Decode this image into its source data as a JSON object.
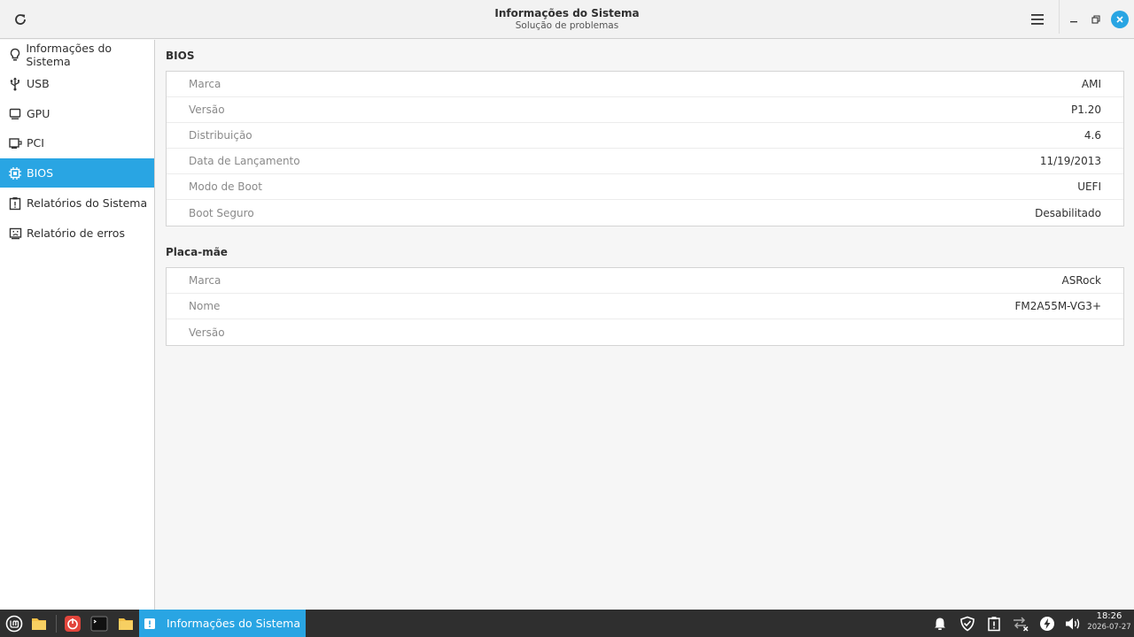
{
  "window": {
    "title": "Informações do Sistema",
    "subtitle": "Solução de problemas"
  },
  "sidebar": {
    "items": [
      {
        "label": "Informações do Sistema",
        "icon": "lightbulb-icon"
      },
      {
        "label": "USB",
        "icon": "usb-icon"
      },
      {
        "label": "GPU",
        "icon": "monitor-icon"
      },
      {
        "label": "PCI",
        "icon": "pci-card-icon"
      },
      {
        "label": "BIOS",
        "icon": "chip-icon",
        "active": true
      },
      {
        "label": "Relatórios do Sistema",
        "icon": "report-icon"
      },
      {
        "label": "Relatório de erros",
        "icon": "sad-face-icon"
      }
    ]
  },
  "bios": {
    "title": "BIOS",
    "rows": [
      {
        "key": "Marca",
        "value": "AMI"
      },
      {
        "key": "Versão",
        "value": "P1.20"
      },
      {
        "key": "Distribuição",
        "value": "4.6"
      },
      {
        "key": "Data de Lançamento",
        "value": "11/19/2013"
      },
      {
        "key": "Modo de Boot",
        "value": "UEFI"
      },
      {
        "key": "Boot Seguro",
        "value": "Desabilitado"
      }
    ]
  },
  "motherboard": {
    "title": "Placa-mãe",
    "rows": [
      {
        "key": "Marca",
        "value": "ASRock"
      },
      {
        "key": "Nome",
        "value": "FM2A55M-VG3+"
      },
      {
        "key": "Versão",
        "value": ""
      }
    ]
  },
  "taskbar": {
    "active_window": "Informações do Sistema",
    "time": "18:26",
    "date": "2026-07-27"
  },
  "colors": {
    "accent": "#29a5e3",
    "taskbar": "#2f2f2f"
  }
}
